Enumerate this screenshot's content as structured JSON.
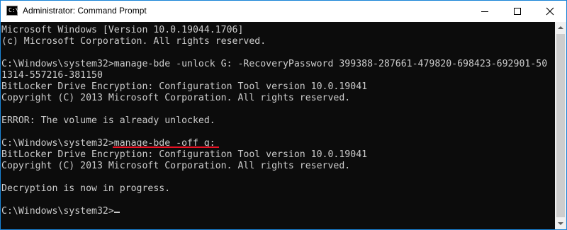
{
  "window": {
    "title": "Administrator: Command Prompt",
    "icon": "cmd-icon",
    "icon_text": "C:\\",
    "controls": {
      "minimize": "minimize-icon",
      "maximize": "maximize-icon",
      "close": "close-icon"
    }
  },
  "console": {
    "lines": [
      "Microsoft Windows [Version 10.0.19044.1706]",
      "(c) Microsoft Corporation. All rights reserved.",
      "",
      "C:\\Windows\\system32>manage-bde -unlock G: -RecoveryPassword 399388-287661-479820-698423-692901-50",
      "1314-557216-381150",
      "BitLocker Drive Encryption: Configuration Tool version 10.0.19041",
      "Copyright (C) 2013 Microsoft Corporation. All rights reserved.",
      "",
      "ERROR: The volume is already unlocked.",
      "",
      "C:\\Windows\\system32>manage-bde -off g:",
      "BitLocker Drive Encryption: Configuration Tool version 10.0.19041",
      "Copyright (C) 2013 Microsoft Corporation. All rights reserved.",
      "",
      "Decryption is now in progress.",
      "",
      "C:\\Windows\\system32>"
    ],
    "highlighted_command": "manage-bde -off g:",
    "highlight_color": "#e81123",
    "text_color": "#cccccc",
    "background_color": "#0c0c0c"
  }
}
